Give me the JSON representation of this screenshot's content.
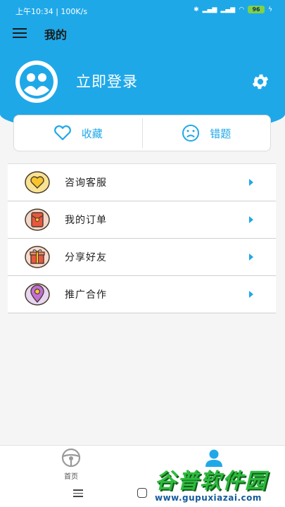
{
  "status_bar": {
    "time": "上午10:34 | 100K/s",
    "battery": "96"
  },
  "header": {
    "title": "我的",
    "login_text": "立即登录"
  },
  "quick_card": {
    "favorites": "收藏",
    "mistakes": "错题"
  },
  "menu_items": [
    {
      "label": "咨询客服",
      "icon": "heart-badge-icon"
    },
    {
      "label": "我的订单",
      "icon": "red-envelope-icon"
    },
    {
      "label": "分享好友",
      "icon": "gift-box-icon"
    },
    {
      "label": "推广合作",
      "icon": "location-pin-icon"
    }
  ],
  "tabbar": {
    "home": "首页",
    "mine": "我的"
  },
  "watermark": {
    "main": "谷普软件园",
    "url": "www.gupuxiazai.com"
  },
  "colors": {
    "accent": "#1fa8e8",
    "background": "#f5f5f5"
  }
}
